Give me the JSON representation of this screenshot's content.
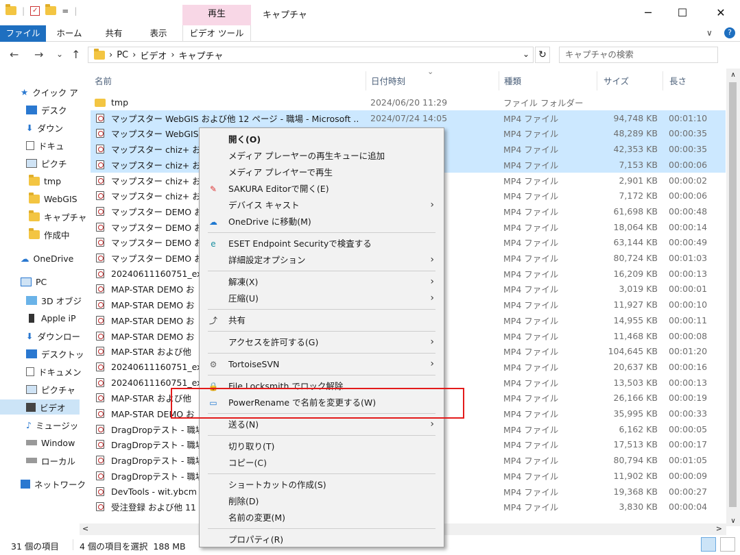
{
  "window": {
    "title": "キャプチャ",
    "context_tab": "再生",
    "minimize": "─",
    "maximize": "☐",
    "close": "✕",
    "qat_sep": "="
  },
  "ribbon": {
    "tabs": [
      "ファイル",
      "ホーム",
      "共有",
      "表示",
      "ビデオ ツール"
    ],
    "help": "?",
    "expand": "∨"
  },
  "address": {
    "back": "←",
    "forward": "→",
    "recent": "⌄",
    "up": "↑",
    "path": [
      "PC",
      "ビデオ",
      "キャプチャ"
    ],
    "separator": "›",
    "dropdown": "⌄",
    "refresh": "↻",
    "search_placeholder": "キャプチャの検索"
  },
  "nav": {
    "quick_access": "クイック ア",
    "items_qa": [
      "デスク",
      "ダウン",
      "ドキュ",
      "ピクチ",
      "tmp",
      "WebGIS",
      "キャプチャ",
      "作成中"
    ],
    "onedrive": "OneDrive",
    "pc": "PC",
    "items_pc": [
      "3D オブジ",
      "Apple iP",
      "ダウンロー",
      "デスクトッ",
      "ドキュメン",
      "ピクチャ",
      "ビデオ",
      "ミュージッ",
      "Window",
      "ローカル"
    ],
    "network": "ネットワーク"
  },
  "columns": {
    "name": "名前",
    "date": "日付時刻",
    "type": "種類",
    "size": "サイズ",
    "length": "長さ",
    "sort": "⌄"
  },
  "files": [
    {
      "name": "tmp",
      "date": "2024/06/20 11:29",
      "type": "ファイル フォルダー",
      "size": "",
      "len": "",
      "folder": true,
      "sel": false
    },
    {
      "name": "マップスター WebGIS および他 12 ページ - 職場 - Microsoft ...",
      "date": "2024/07/24 14:05",
      "type": "MP4 ファイル",
      "size": "94,748 KB",
      "len": "00:01:10",
      "sel": true
    },
    {
      "name": "マップスター WebGIS お",
      "date": "",
      "type": "MP4 ファイル",
      "size": "48,289 KB",
      "len": "00:00:35",
      "sel": true
    },
    {
      "name": "マップスター chiz+ およ",
      "date": "",
      "type": "MP4 ファイル",
      "size": "42,353 KB",
      "len": "00:00:35",
      "sel": true
    },
    {
      "name": "マップスター chiz+ およ",
      "date": "",
      "type": "MP4 ファイル",
      "size": "7,153 KB",
      "len": "00:00:06",
      "sel": true
    },
    {
      "name": "マップスター chiz+ およ",
      "date": "",
      "type": "MP4 ファイル",
      "size": "2,901 KB",
      "len": "00:00:02",
      "sel": false
    },
    {
      "name": "マップスター chiz+ およ",
      "date": "",
      "type": "MP4 ファイル",
      "size": "7,172 KB",
      "len": "00:00:06",
      "sel": false
    },
    {
      "name": "マップスター DEMO およ",
      "date": "",
      "type": "MP4 ファイル",
      "size": "61,698 KB",
      "len": "00:00:48",
      "sel": false
    },
    {
      "name": "マップスター DEMO およ",
      "date": "",
      "type": "MP4 ファイル",
      "size": "18,064 KB",
      "len": "00:00:14",
      "sel": false
    },
    {
      "name": "マップスター DEMO およ",
      "date": "",
      "type": "MP4 ファイル",
      "size": "63,144 KB",
      "len": "00:00:49",
      "sel": false
    },
    {
      "name": "マップスター DEMO およ",
      "date": "",
      "type": "MP4 ファイル",
      "size": "80,724 KB",
      "len": "00:01:03",
      "sel": false
    },
    {
      "name": "20240611160751_exp",
      "date": "",
      "type": "MP4 ファイル",
      "size": "16,209 KB",
      "len": "00:00:13",
      "sel": false
    },
    {
      "name": "MAP-STAR DEMO お",
      "date": "",
      "type": "MP4 ファイル",
      "size": "3,019 KB",
      "len": "00:00:01",
      "sel": false
    },
    {
      "name": "MAP-STAR DEMO お",
      "date": "",
      "type": "MP4 ファイル",
      "size": "11,927 KB",
      "len": "00:00:10",
      "sel": false
    },
    {
      "name": "MAP-STAR DEMO お",
      "date": "",
      "type": "MP4 ファイル",
      "size": "14,955 KB",
      "len": "00:00:11",
      "sel": false
    },
    {
      "name": "MAP-STAR DEMO お",
      "date": "",
      "type": "MP4 ファイル",
      "size": "11,468 KB",
      "len": "00:00:08",
      "sel": false
    },
    {
      "name": "MAP-STAR および他",
      "date": "",
      "type": "MP4 ファイル",
      "size": "104,645 KB",
      "len": "00:01:20",
      "sel": false
    },
    {
      "name": "20240611160751_exp",
      "date": "",
      "type": "MP4 ファイル",
      "size": "20,637 KB",
      "len": "00:00:16",
      "sel": false
    },
    {
      "name": "20240611160751_exp",
      "date": "",
      "type": "MP4 ファイル",
      "size": "13,503 KB",
      "len": "00:00:13",
      "sel": false
    },
    {
      "name": "MAP-STAR および他",
      "date": "",
      "type": "MP4 ファイル",
      "size": "26,166 KB",
      "len": "00:00:19",
      "sel": false
    },
    {
      "name": "MAP-STAR DEMO お",
      "date": "",
      "type": "MP4 ファイル",
      "size": "35,995 KB",
      "len": "00:00:33",
      "sel": false
    },
    {
      "name": "DragDropテスト - 職場",
      "date": "",
      "type": "MP4 ファイル",
      "size": "6,162 KB",
      "len": "00:00:05",
      "sel": false
    },
    {
      "name": "DragDropテスト - 職場",
      "date": "",
      "type": "MP4 ファイル",
      "size": "17,513 KB",
      "len": "00:00:17",
      "sel": false
    },
    {
      "name": "DragDropテスト - 職場",
      "date": "",
      "type": "MP4 ファイル",
      "size": "80,794 KB",
      "len": "00:01:05",
      "sel": false
    },
    {
      "name": "DragDropテスト - 職場",
      "date": "",
      "type": "MP4 ファイル",
      "size": "11,902 KB",
      "len": "00:00:09",
      "sel": false
    },
    {
      "name": "DevTools - wit.ybcm",
      "date": "",
      "type": "MP4 ファイル",
      "size": "19,368 KB",
      "len": "00:00:27",
      "sel": false
    },
    {
      "name": "受注登録 および他 11",
      "date": "",
      "type": "MP4 ファイル",
      "size": "3,830 KB",
      "len": "00:00:04",
      "sel": false
    }
  ],
  "context_menu": {
    "items": [
      {
        "label": "開く(O)",
        "bold": true
      },
      {
        "label": "メディア プレーヤーの再生キューに追加"
      },
      {
        "label": "メディア プレイヤーで再生"
      },
      {
        "label": "SAKURA Editorで開く(E)",
        "icon": "sakura-icon"
      },
      {
        "label": "デバイス キャスト",
        "sub": true
      },
      {
        "label": "OneDrive に移動(M)",
        "icon": "onedrive-icon"
      },
      {
        "sep": true
      },
      {
        "label": "ESET Endpoint Securityで検査する",
        "icon": "eset-icon"
      },
      {
        "label": "詳細設定オプション",
        "sub": true
      },
      {
        "sep": true
      },
      {
        "label": "解凍(X)",
        "sub": true
      },
      {
        "label": "圧縮(U)",
        "sub": true
      },
      {
        "sep": true
      },
      {
        "label": "共有",
        "icon": "share-icon"
      },
      {
        "sep": true
      },
      {
        "label": "アクセスを許可する(G)",
        "sub": true
      },
      {
        "sep": true
      },
      {
        "label": "TortoiseSVN",
        "icon": "tortoise-icon",
        "sub": true
      },
      {
        "sep": true
      },
      {
        "label": "File Locksmith でロック解除",
        "icon": "lock-icon"
      },
      {
        "label": "PowerRename で名前を変更する(W)",
        "icon": "powerrename-icon"
      },
      {
        "sep": true
      },
      {
        "label": "送る(N)",
        "sub": true
      },
      {
        "sep": true
      },
      {
        "label": "切り取り(T)"
      },
      {
        "label": "コピー(C)"
      },
      {
        "sep": true
      },
      {
        "label": "ショートカットの作成(S)"
      },
      {
        "label": "削除(D)"
      },
      {
        "label": "名前の変更(M)"
      },
      {
        "sep": true
      },
      {
        "label": "プロパティ(R)"
      }
    ]
  },
  "status": {
    "count": "31 個の項目",
    "selected": "4 個の項目を選択  188 MB"
  },
  "scroll": {
    "up": "∧",
    "down": "∨",
    "left": "<",
    "right": ">"
  },
  "colors": {
    "accent": "#1e6fc0",
    "selection": "#cce8ff",
    "highlight_box": "#e31a1a",
    "context_tab": "#f8d7e6"
  }
}
